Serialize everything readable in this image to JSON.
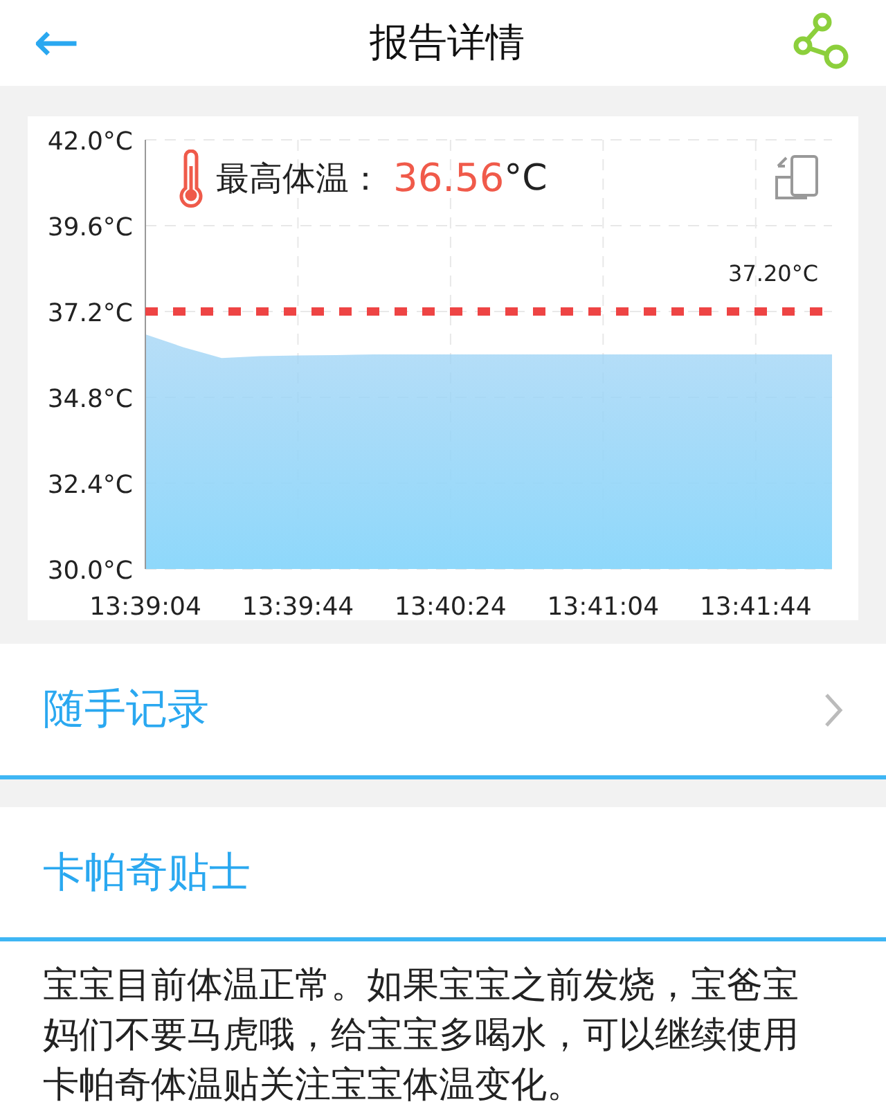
{
  "header": {
    "back": "←",
    "title": "报告详情"
  },
  "chart": {
    "max_label": "最高体温：",
    "max_value": "36.56",
    "max_unit": "°C",
    "chart_data": {
      "type": "area",
      "categories": [
        "13:39:04",
        null,
        null,
        null,
        "13:39:44",
        null,
        null,
        null,
        "13:40:24",
        null,
        null,
        null,
        "13:41:04",
        null,
        null,
        null,
        "13:41:44",
        null,
        null
      ],
      "ylim": [
        30,
        42
      ],
      "grid": true,
      "yticks": [
        {
          "value": 30,
          "label": "30.0°C"
        },
        {
          "value": 32.4,
          "label": "32.4°C"
        },
        {
          "value": 34.8,
          "label": "34.8°C"
        },
        {
          "value": 37.2,
          "label": "37.2°C"
        },
        {
          "value": 39.6,
          "label": "39.6°C"
        },
        {
          "value": 42,
          "label": "42.0°C"
        }
      ],
      "series": [
        {
          "color": "#9fd3f5",
          "values": [
            36.56,
            36.2,
            35.9,
            35.95,
            35.97,
            35.98,
            36.0,
            36.0,
            36.0,
            36.0,
            36.0,
            36.0,
            36.0,
            36.0,
            36.0,
            36.0,
            36.0,
            36.0,
            36.0
          ]
        },
        {
          "name": "37.20°C",
          "type": "line",
          "line_style": "dotted",
          "color": "#ee4444",
          "values": [
            37.2,
            37.2,
            37.2,
            37.2,
            37.2,
            37.2,
            37.2,
            37.2,
            37.2,
            37.2,
            37.2,
            37.2,
            37.2,
            37.2,
            37.2,
            37.2,
            37.2,
            37.2,
            37.2
          ]
        }
      ]
    }
  },
  "notes_row": {
    "label": "随手记录"
  },
  "tips": {
    "title": "卡帕奇贴士",
    "text": "宝宝目前体温正常。如果宝宝之前发烧，宝爸宝妈们不要马虎哦，给宝宝多喝水，可以继续使用卡帕奇体温贴关注宝宝体温变化。"
  }
}
